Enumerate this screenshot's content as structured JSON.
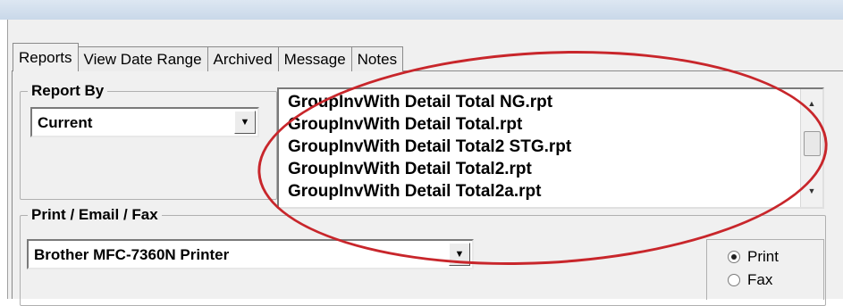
{
  "tabs": [
    "Reports",
    "View Date Range",
    "Archived",
    "Message",
    "Notes"
  ],
  "report_by": {
    "legend": "Report By",
    "selected": "Current"
  },
  "report_list": [
    "GroupInvWith Detail Total NG.rpt",
    "GroupInvWith Detail Total.rpt",
    "GroupInvWith Detail Total2 STG.rpt",
    "GroupInvWith Detail Total2.rpt",
    "GroupInvWith Detail Total2a.rpt"
  ],
  "print_email_fax": {
    "legend": "Print / Email / Fax",
    "printer": "Brother MFC-7360N Printer",
    "options": [
      "Print",
      "Fax"
    ],
    "selected_option": "Print"
  },
  "annotation_color": "#c8262b"
}
